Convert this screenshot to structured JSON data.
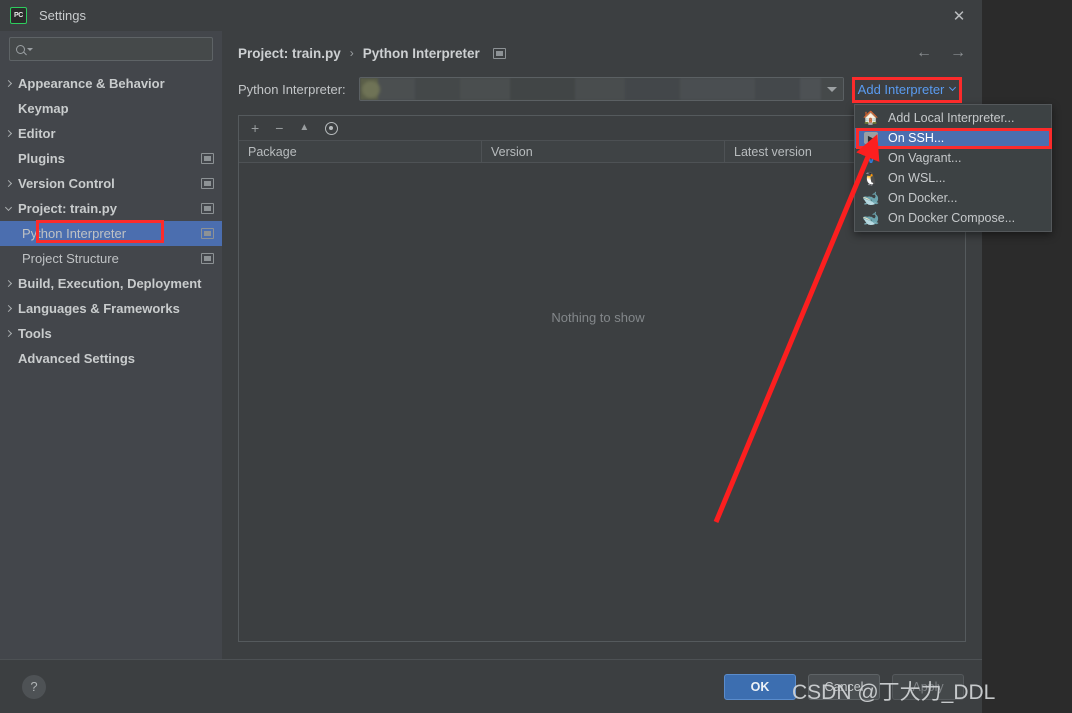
{
  "window": {
    "title": "Settings",
    "logo_text": "PC",
    "close_icon": "close-icon"
  },
  "sidebar": {
    "search": {
      "value": "",
      "placeholder": ""
    },
    "items": [
      {
        "label": "Appearance & Behavior",
        "expandable": true,
        "expanded": false,
        "depth": 0,
        "badge": false,
        "bold": true
      },
      {
        "label": "Keymap",
        "expandable": false,
        "expanded": false,
        "depth": 0,
        "badge": false,
        "bold": true
      },
      {
        "label": "Editor",
        "expandable": true,
        "expanded": false,
        "depth": 0,
        "badge": false,
        "bold": true
      },
      {
        "label": "Plugins",
        "expandable": false,
        "expanded": false,
        "depth": 0,
        "badge": true,
        "bold": true
      },
      {
        "label": "Version Control",
        "expandable": true,
        "expanded": false,
        "depth": 0,
        "badge": true,
        "bold": true
      },
      {
        "label": "Project: train.py",
        "expandable": true,
        "expanded": true,
        "depth": 0,
        "badge": true,
        "bold": true
      },
      {
        "label": "Python Interpreter",
        "expandable": false,
        "expanded": false,
        "depth": 1,
        "badge": true,
        "bold": false,
        "selected": true
      },
      {
        "label": "Project Structure",
        "expandable": false,
        "expanded": false,
        "depth": 1,
        "badge": true,
        "bold": false
      },
      {
        "label": "Build, Execution, Deployment",
        "expandable": true,
        "expanded": false,
        "depth": 0,
        "badge": false,
        "bold": true
      },
      {
        "label": "Languages & Frameworks",
        "expandable": true,
        "expanded": false,
        "depth": 0,
        "badge": false,
        "bold": true
      },
      {
        "label": "Tools",
        "expandable": true,
        "expanded": false,
        "depth": 0,
        "badge": false,
        "bold": true
      },
      {
        "label": "Advanced Settings",
        "expandable": false,
        "expanded": false,
        "depth": 0,
        "badge": false,
        "bold": true
      }
    ]
  },
  "content": {
    "breadcrumb": {
      "parent": "Project: train.py",
      "separator": "›",
      "current": "Python Interpreter"
    },
    "nav": {
      "back_icon": "←",
      "forward_icon": "→"
    },
    "interpreter": {
      "label": "Python Interpreter:",
      "value": "",
      "redacted": true,
      "dropdown_icon": "chevron-down-icon",
      "add_button": "Add Interpreter",
      "add_button_color": "#5a9bf0"
    },
    "packages": {
      "toolbar": {
        "add": "+",
        "remove": "−",
        "upgrade": "▲",
        "show_early": "eye-icon"
      },
      "columns": [
        "Package",
        "Version",
        "Latest version"
      ],
      "rows": [],
      "empty_text": "Nothing to show"
    }
  },
  "menu": {
    "items": [
      {
        "label": "Add Local Interpreter...",
        "icon": "home-icon",
        "selected": false
      },
      {
        "label": "On SSH...",
        "icon": "ssh-terminal-icon",
        "selected": true
      },
      {
        "label": "On Vagrant...",
        "icon": "vagrant-icon",
        "selected": false
      },
      {
        "label": "On WSL...",
        "icon": "wsl-penguin-icon",
        "selected": false
      },
      {
        "label": "On Docker...",
        "icon": "docker-whale-icon",
        "selected": false
      },
      {
        "label": "On Docker Compose...",
        "icon": "docker-compose-icon",
        "selected": false
      }
    ]
  },
  "footer": {
    "help": "?",
    "ok": "OK",
    "cancel": "Cancel",
    "apply": "Apply"
  },
  "annotations": {
    "watermark": "CSDN @丁大力_DDL",
    "highlight_color": "#fc2b2b"
  }
}
